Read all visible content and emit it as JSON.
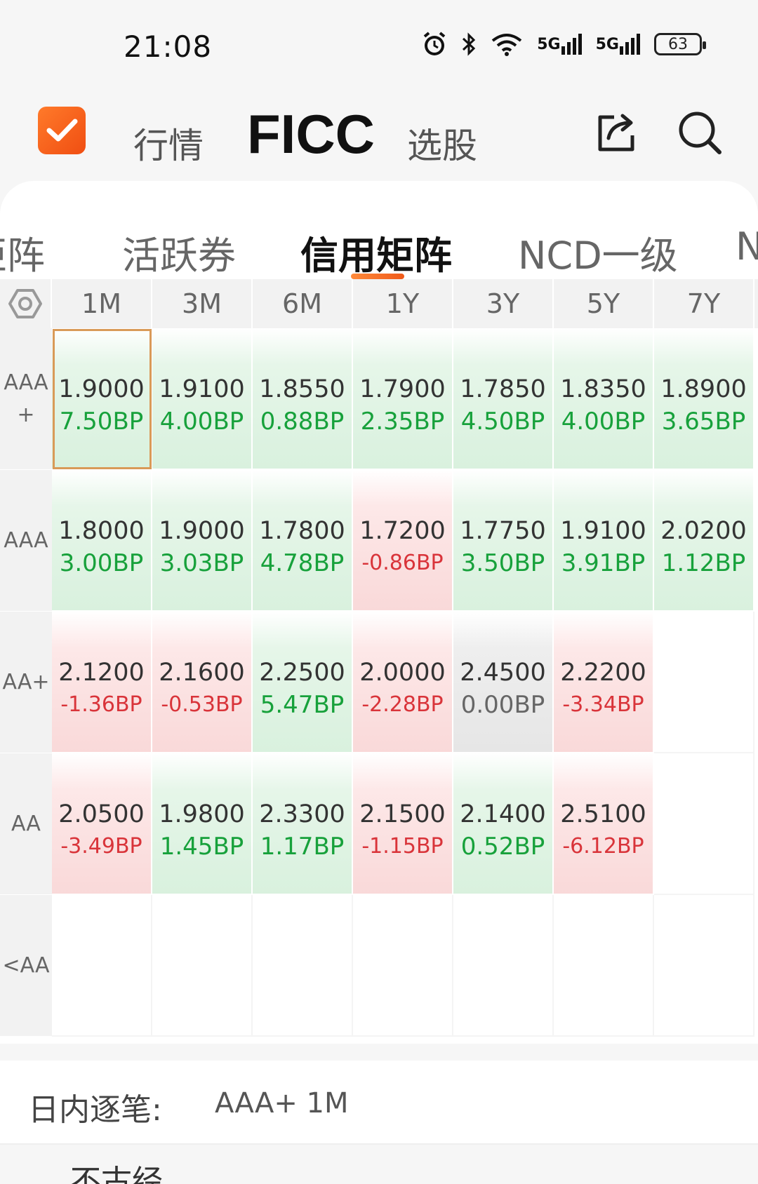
{
  "status_bar": {
    "time": "21:08",
    "signal_1": "5G",
    "signal_2": "5G",
    "battery": "63"
  },
  "header": {
    "nav": [
      "行情",
      "FICC",
      "选股"
    ],
    "active": "FICC"
  },
  "tabs": [
    "矩阵",
    "活跃券",
    "信用矩阵",
    "NCD一级",
    "N"
  ],
  "active_tab": "信用矩阵",
  "matrix": {
    "columns": [
      "1M",
      "3M",
      "6M",
      "1Y",
      "3Y",
      "5Y",
      "7Y"
    ],
    "rows": [
      {
        "label": "AAA+",
        "cells": [
          {
            "value": "1.9000",
            "change": "7.50BP",
            "trend": "up"
          },
          {
            "value": "1.9100",
            "change": "4.00BP",
            "trend": "up"
          },
          {
            "value": "1.8550",
            "change": "0.88BP",
            "trend": "up"
          },
          {
            "value": "1.7900",
            "change": "2.35BP",
            "trend": "up"
          },
          {
            "value": "1.7850",
            "change": "4.50BP",
            "trend": "up"
          },
          {
            "value": "1.8350",
            "change": "4.00BP",
            "trend": "up"
          },
          {
            "value": "1.8900",
            "change": "3.65BP",
            "trend": "up"
          }
        ]
      },
      {
        "label": "AAA",
        "cells": [
          {
            "value": "1.8000",
            "change": "3.00BP",
            "trend": "up"
          },
          {
            "value": "1.9000",
            "change": "3.03BP",
            "trend": "up"
          },
          {
            "value": "1.7800",
            "change": "4.78BP",
            "trend": "up"
          },
          {
            "value": "1.7200",
            "change": "-0.86BP",
            "trend": "down"
          },
          {
            "value": "1.7750",
            "change": "3.50BP",
            "trend": "up"
          },
          {
            "value": "1.9100",
            "change": "3.91BP",
            "trend": "up"
          },
          {
            "value": "2.0200",
            "change": "1.12BP",
            "trend": "up"
          }
        ]
      },
      {
        "label": "AA+",
        "cells": [
          {
            "value": "2.1200",
            "change": "-1.36BP",
            "trend": "down"
          },
          {
            "value": "2.1600",
            "change": "-0.53BP",
            "trend": "down"
          },
          {
            "value": "2.2500",
            "change": "5.47BP",
            "trend": "up"
          },
          {
            "value": "2.0000",
            "change": "-2.28BP",
            "trend": "down"
          },
          {
            "value": "2.4500",
            "change": "0.00BP",
            "trend": "flat"
          },
          {
            "value": "2.2200",
            "change": "-3.34BP",
            "trend": "down"
          },
          {
            "value": "",
            "change": "",
            "trend": "empty"
          }
        ]
      },
      {
        "label": "AA",
        "cells": [
          {
            "value": "2.0500",
            "change": "-3.49BP",
            "trend": "down"
          },
          {
            "value": "1.9800",
            "change": "1.45BP",
            "trend": "up"
          },
          {
            "value": "2.3300",
            "change": "1.17BP",
            "trend": "up"
          },
          {
            "value": "2.1500",
            "change": "-1.15BP",
            "trend": "down"
          },
          {
            "value": "2.1400",
            "change": "0.52BP",
            "trend": "up"
          },
          {
            "value": "2.5100",
            "change": "-6.12BP",
            "trend": "down"
          },
          {
            "value": "",
            "change": "",
            "trend": "empty"
          }
        ]
      },
      {
        "label": "<AA",
        "cells": [
          {
            "value": "",
            "change": "",
            "trend": "empty"
          },
          {
            "value": "",
            "change": "",
            "trend": "empty"
          },
          {
            "value": "",
            "change": "",
            "trend": "empty"
          },
          {
            "value": "",
            "change": "",
            "trend": "empty"
          },
          {
            "value": "",
            "change": "",
            "trend": "empty"
          },
          {
            "value": "",
            "change": "",
            "trend": "empty"
          },
          {
            "value": "",
            "change": "",
            "trend": "empty"
          }
        ]
      }
    ],
    "selected": {
      "row": "AAA+",
      "column": "1M"
    }
  },
  "intraday": {
    "label": "日内逐笔:",
    "selection": "AAA+ 1M"
  },
  "bottom_peek": "不古经",
  "colors": {
    "accent": "#f05a1a",
    "up": "#17a13b",
    "down": "#d9343a"
  },
  "icons": [
    "alarm-icon",
    "bluetooth-icon",
    "wifi-icon",
    "signal-icon",
    "battery-icon",
    "app-logo-icon",
    "share-icon",
    "search-icon",
    "settings-hex-icon"
  ]
}
